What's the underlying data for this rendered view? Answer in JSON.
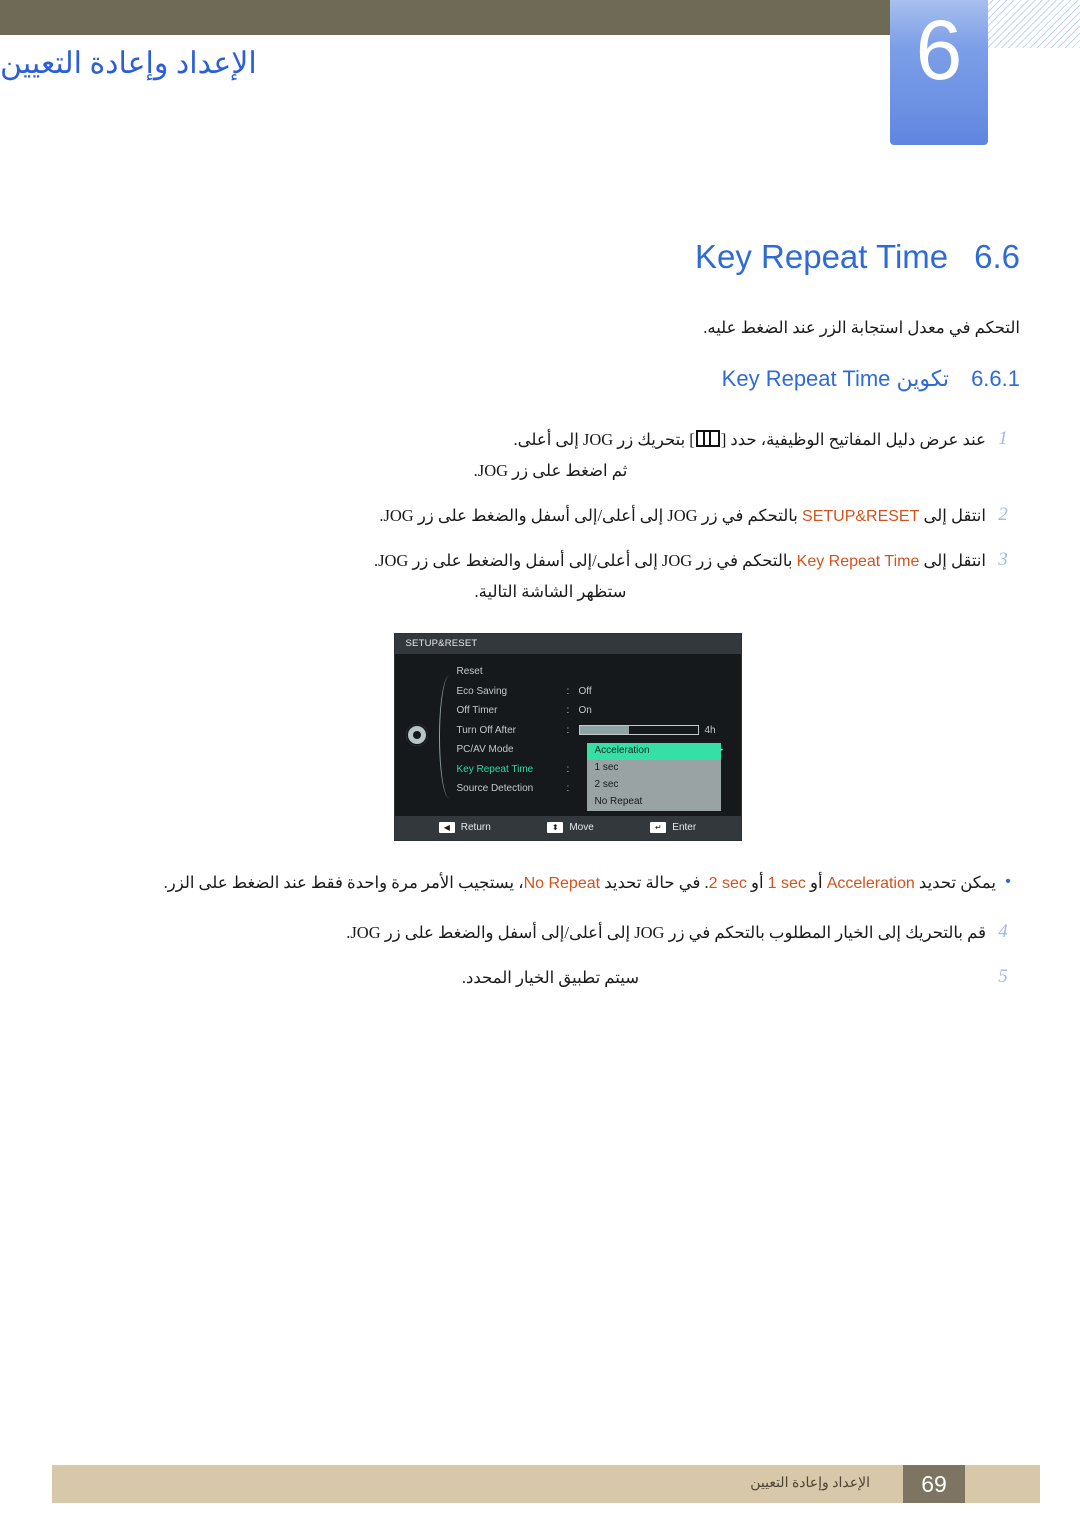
{
  "header": {
    "chapter_number": "6",
    "chapter_title": "الإعداد وإعادة التعيين"
  },
  "section": {
    "number": "6.6",
    "name": "Key Repeat Time",
    "intro": "التحكم في معدل استجابة الزر عند الضغط عليه."
  },
  "subsection": {
    "number": "6.6.1",
    "name_prefix": "تكوين",
    "name_term": "Key Repeat Time"
  },
  "steps": [
    {
      "num": "1",
      "text_before": "عند عرض دليل المفاتيح الوظيفية، حدد [",
      "glyph": "jog-icon",
      "text_after": "] بتحريك زر JOG إلى أعلى.",
      "sub": "ثم اضغط على زر JOG."
    },
    {
      "num": "2",
      "text_before": "انتقل إلى",
      "highlight": "SETUP&RESET",
      "text_after": "بالتحكم في زر JOG إلى أعلى/إلى أسفل والضغط على زر JOG.",
      "sub": ""
    },
    {
      "num": "3",
      "text_before": "انتقل إلى",
      "highlight": "Key Repeat Time",
      "text_after": "بالتحكم في زر JOG إلى أعلى/إلى أسفل والضغط على زر JOG.",
      "sub": "ستظهر الشاشة التالية."
    }
  ],
  "osd": {
    "title": "SETUP&RESET",
    "rows": [
      {
        "label": "Reset",
        "colon": "",
        "value": "",
        "type": "plain",
        "active": false
      },
      {
        "label": "Eco Saving",
        "colon": ":",
        "value": "Off",
        "type": "plain",
        "active": false
      },
      {
        "label": "Off Timer",
        "colon": ":",
        "value": "On",
        "type": "plain",
        "active": false
      },
      {
        "label": "Turn Off After",
        "colon": ":",
        "value": "4h",
        "type": "bar",
        "active": false,
        "bar_percent": 42
      },
      {
        "label": "PC/AV Mode",
        "colon": "",
        "value": "",
        "type": "arrow",
        "active": false
      },
      {
        "label": "Key Repeat Time",
        "colon": ":",
        "value": "",
        "type": "plain",
        "active": true
      },
      {
        "label": "Source Detection",
        "colon": ":",
        "value": "",
        "type": "plain",
        "active": false
      }
    ],
    "dropdown": {
      "options": [
        "Acceleration",
        "1 sec",
        "2 sec",
        "No Repeat"
      ],
      "selected": "Acceleration"
    },
    "footer": [
      {
        "icon": "left-arrow-icon",
        "glyph": "◀",
        "label": "Return"
      },
      {
        "icon": "updown-arrow-icon",
        "glyph": "⬍",
        "label": "Move"
      },
      {
        "icon": "enter-key-icon",
        "glyph": "↵",
        "label": "Enter"
      }
    ]
  },
  "note": {
    "bullet": "•",
    "t1": "يمكن تحديد",
    "h1": "Acceleration",
    "t2": "أو",
    "h2": "1 sec",
    "t3": "أو",
    "h3": "2 sec",
    "t4": ". في حالة تحديد",
    "h4": "No Repeat",
    "t5": "، يستجيب الأمر مرة واحدة فقط عند الضغط على الزر."
  },
  "steps_late": [
    {
      "num": "4",
      "text": "قم بالتحريك إلى الخيار المطلوب بالتحكم في زر JOG إلى أعلى/إلى أسفل والضغط على زر JOG."
    },
    {
      "num": "5",
      "text": "سيتم تطبيق الخيار المحدد."
    }
  ],
  "footer": {
    "title": "الإعداد وإعادة التعيين",
    "page_number": "69"
  },
  "colors": {
    "accent_blue": "#2f6bd6",
    "highlight_orange": "#d4521e",
    "header_bar": "#6e6a56",
    "tab_blue": "#7d9fe8",
    "footer_band": "#d6c8a8",
    "footer_box": "#7d7461",
    "osd_green": "#34e0a3"
  }
}
